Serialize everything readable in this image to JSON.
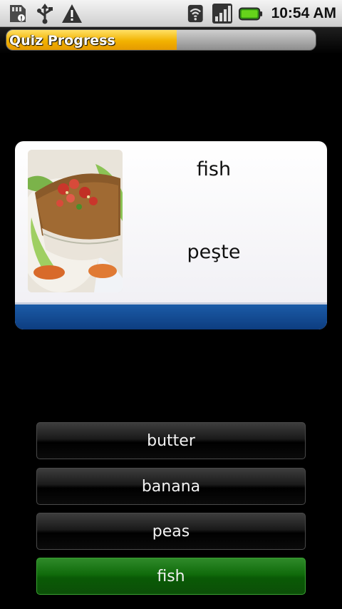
{
  "status_bar": {
    "left_icons": [
      "sd-card-icon",
      "usb-icon",
      "warning-icon"
    ],
    "right_icons": [
      "wifi-icon",
      "signal-icon",
      "battery-icon"
    ],
    "time": "10:54 AM"
  },
  "quiz": {
    "title": "Quiz Progress",
    "progress_fraction": 0.55,
    "accent_color": "#f2b200"
  },
  "card": {
    "image": "fish-dish-photo",
    "word": "fish",
    "translation": "peşte",
    "footer_color": "#13498f"
  },
  "answers": [
    {
      "label": "butter",
      "correct": false
    },
    {
      "label": "banana",
      "correct": false
    },
    {
      "label": "peas",
      "correct": false
    },
    {
      "label": "fish",
      "correct": true
    }
  ]
}
